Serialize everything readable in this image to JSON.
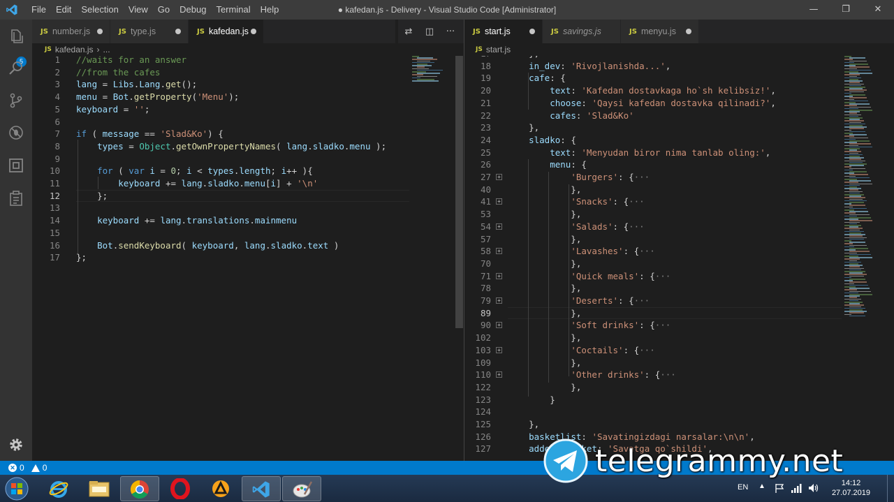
{
  "window": {
    "title": "● kafedan.js - Delivery - Visual Studio Code [Administrator]",
    "menu": [
      "File",
      "Edit",
      "Selection",
      "View",
      "Go",
      "Debug",
      "Terminal",
      "Help"
    ],
    "controls": [
      "—",
      "❐",
      "✕"
    ]
  },
  "activity": {
    "scm_badge": "5"
  },
  "left": {
    "tabs": [
      {
        "label": "number.js",
        "ext": "JS",
        "active": false,
        "dirty": true
      },
      {
        "label": "type.js",
        "ext": "JS",
        "active": false,
        "dirty": true
      },
      {
        "label": "kafedan.js",
        "ext": "JS",
        "active": true,
        "dirty": true
      }
    ],
    "breadcrumb": {
      "ext": "JS",
      "file": "kafedan.js",
      "sep": "›",
      "more": "..."
    },
    "current_line": 12
  },
  "right": {
    "tabs": [
      {
        "label": "start.js",
        "ext": "JS",
        "active": true,
        "dirty": true
      },
      {
        "label": "savings.js",
        "ext": "JS",
        "active": false,
        "dirty": false,
        "italic": true
      },
      {
        "label": "menyu.js",
        "ext": "JS",
        "active": false,
        "dirty": true
      }
    ],
    "breadcrumb": {
      "ext": "JS",
      "file": "start.js"
    },
    "current_line": 89
  },
  "status": {
    "errors": "0",
    "warnings": "0"
  },
  "taskbar": {
    "apps": [
      "start",
      "internet-explorer",
      "file-explorer",
      "chrome",
      "opera",
      "avast",
      "vscode",
      "paint"
    ],
    "lang": "EN",
    "time": "14:12",
    "date": "27.07.2019"
  },
  "watermark": {
    "text": "telegrammy.net"
  }
}
